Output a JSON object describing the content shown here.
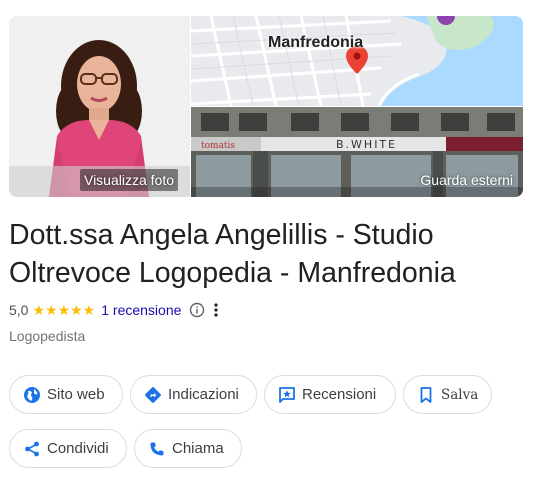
{
  "gallery": {
    "main_caption": "Visualizza foto",
    "map_label": "Manfredonia",
    "street_caption": "Guarda esterni",
    "street_sign": "B.WHITE",
    "street_sign_left": "tomatis"
  },
  "title": "Dott.ssa Angela Angelillis - Studio Oltrevoce Logopedia - Manfredonia",
  "rating": {
    "value": "5,0",
    "stars": "★★★★★",
    "review_link": "1 recensione"
  },
  "category": "Logopedista",
  "actions": {
    "website": "Sito web",
    "directions": "Indicazioni",
    "reviews": "Recensioni",
    "save": "Salva",
    "share": "Condividi",
    "call": "Chiama"
  },
  "colors": {
    "accent_blue": "#1a73e8",
    "link": "#1a0dab",
    "star": "#fbbc04",
    "map_pin": "#ea4335"
  }
}
